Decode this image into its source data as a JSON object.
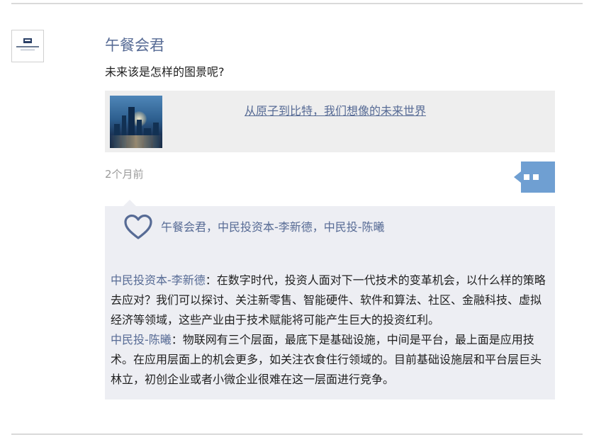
{
  "post": {
    "author": "午餐会君",
    "text": "未来该是怎样的图景呢?",
    "time": "2个月前"
  },
  "link": {
    "title": "从原子到比特，我们想像的未来世界"
  },
  "likes": {
    "names": "午餐会君，中民投资本-李新德，中民投-陈曦"
  },
  "comments": [
    {
      "author": "中民投资本-李新德",
      "separator": "：",
      "text": "在数字时代，投资人面对下一代技术的变革机会，以什么样的策略去应对？我们可以探讨、关注新零售、智能硬件、软件和算法、社区、金融科技、虚拟经济等领域，这些产业由于技术赋能将可能产生巨大的投资红利。"
    },
    {
      "author": "中民投-陈曦",
      "separator": "：",
      "text": "物联网有三个层面，最底下是基础设施，中间是平台，最上面是应用技术。在应用层面上的机会更多，如关注衣食住行领域的。目前基础设施层和平台层巨头林立，初创企业或者小微企业很难在这一层面进行竞争。"
    }
  ],
  "icons": {
    "avatar": "company-logo-icon",
    "more": "comment-more-icon",
    "like": "heart-icon"
  },
  "colors": {
    "link_blue": "#576b95",
    "accent_button": "#6f9fd2",
    "panel_bg": "#edeef3",
    "card_bg": "#eeeeee"
  }
}
